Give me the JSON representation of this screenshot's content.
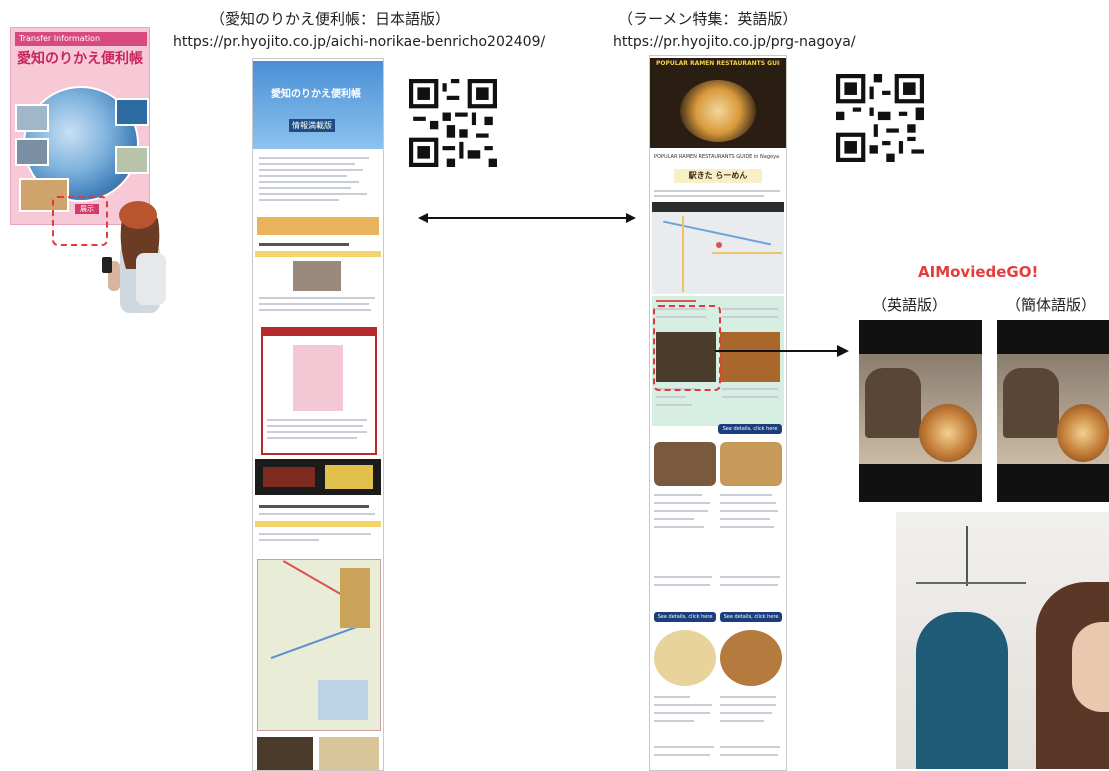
{
  "left": {
    "caption": "（愛知のりかえ便利帳：日本語版）",
    "url": "https://pr.hyojito.co.jp/aichi-norikae-benricho202409/"
  },
  "right": {
    "caption": "（ラーメン特集：英語版）",
    "url": "https://pr.hyojito.co.jp/prg-nagoya/"
  },
  "brochure": {
    "header": "Transfer Information",
    "title": "愛知のりかえ便利帳",
    "badge": "展示"
  },
  "phone_jp": {
    "hero_title": "愛知のりかえ便利帳",
    "hero_sub": "情報満載版"
  },
  "phone_en": {
    "hero_title": "POPULAR RAMEN RESTAURANTS GUIDE in Nagoya",
    "intro": "POPULAR RAMEN RESTAURANTS GUIDE in Nagoya",
    "shop": "駅きた らーめん",
    "buttons": [
      "See details, click here",
      "See details, click here",
      "See details, click here"
    ]
  },
  "ai": {
    "title": "AIMoviedeGO!",
    "labels": [
      "（英語版）",
      "（簡体語版）"
    ]
  },
  "colors": {
    "accent_red": "#e53b3b",
    "button_blue": "#1d3e7c",
    "mint": "#d7efe3"
  },
  "icons": [
    "qr-code-icon",
    "double-arrow-icon",
    "right-arrow-icon"
  ]
}
